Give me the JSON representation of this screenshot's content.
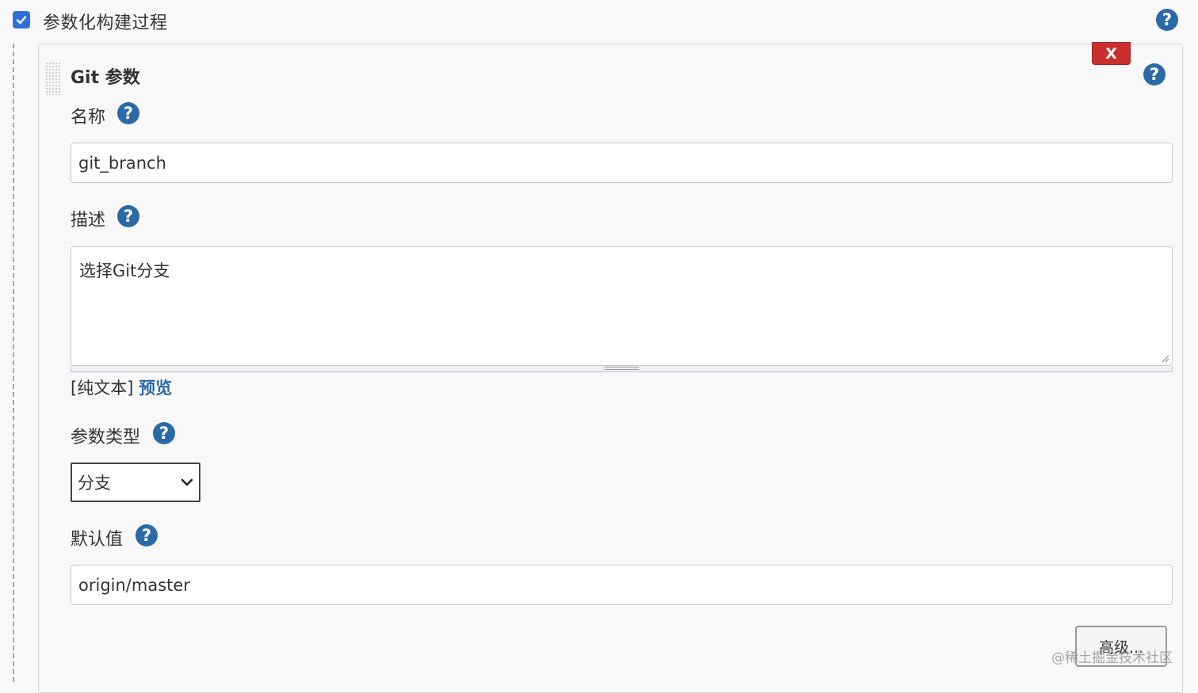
{
  "header": {
    "checkbox_checked": true,
    "title": "参数化构建过程"
  },
  "parameter_block": {
    "title": "Git 参数",
    "delete_label": "X"
  },
  "fields": {
    "name": {
      "label": "名称",
      "value": "git_branch"
    },
    "description": {
      "label": "描述",
      "value": "选择Git分支",
      "format_label": "[纯文本]",
      "preview_label": "预览"
    },
    "parameter_type": {
      "label": "参数类型",
      "selected": "分支"
    },
    "default_value": {
      "label": "默认值",
      "value": "origin/master"
    }
  },
  "advanced_label": "高级...",
  "watermark": "@稀土掘金技术社区",
  "help_glyph": "?",
  "colors": {
    "accent": "#2b6aa6",
    "checkbox": "#2f6fdc",
    "delete": "#c9302c"
  }
}
